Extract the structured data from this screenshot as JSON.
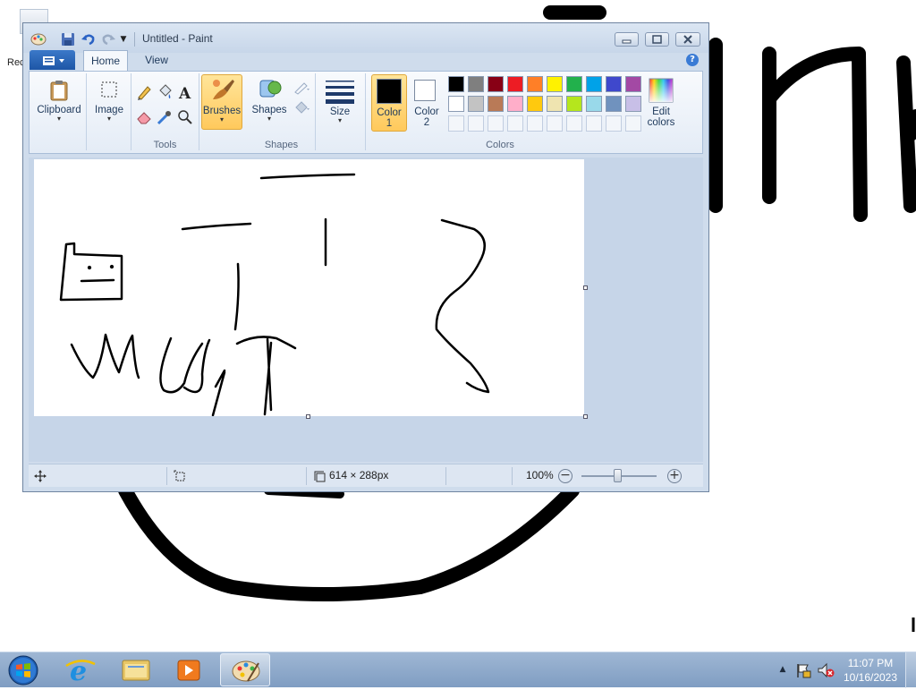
{
  "desktop": {
    "recycle_bin_label": "Rec",
    "icons": {
      "recycle_bin": "recycle-bin-icon"
    }
  },
  "window": {
    "title": "Untitled - Paint",
    "quick_access": [
      "paint-app-icon",
      "save-icon",
      "undo-icon",
      "redo-icon",
      "customize-arrow-icon"
    ],
    "caption_buttons": [
      "minimize",
      "maximize",
      "close"
    ]
  },
  "ribbon": {
    "tabs": [
      "Home",
      "View"
    ],
    "active_tab": "Home",
    "groups": {
      "clipboard": {
        "label": "Clipboard",
        "arrow": "▾"
      },
      "image": {
        "label": "Image",
        "arrow": "▾"
      },
      "tools": {
        "label": "Tools",
        "items": [
          "pencil",
          "fill",
          "text",
          "eraser",
          "color-picker",
          "magnifier"
        ]
      },
      "brushes": {
        "label": "Brushes",
        "arrow": "▾"
      },
      "shapes": {
        "label": "Shapes",
        "group_label": "Shapes",
        "arrow": "▾"
      },
      "size": {
        "label": "Size",
        "arrow": "▾"
      },
      "colors": {
        "group_label": "Colors",
        "color1_label_line1": "Color",
        "color1_label_line2": "1",
        "color2_label_line1": "Color",
        "color2_label_line2": "2",
        "color1_value": "#000000",
        "color2_value": "#ffffff",
        "palette_row1": [
          "#000000",
          "#7f7f7f",
          "#880015",
          "#ed1c24",
          "#ff7f27",
          "#fff200",
          "#22b14c",
          "#00a2e8",
          "#3f48cc",
          "#a349a4"
        ],
        "palette_row2": [
          "#ffffff",
          "#c3c3c3",
          "#b97a57",
          "#ffaec9",
          "#ffc90e",
          "#efe4b0",
          "#b5e61d",
          "#99d9ea",
          "#7092be",
          "#c8bfe7"
        ],
        "palette_row3_empty_count": 10
      },
      "edit_colors": {
        "label_line1": "Edit",
        "label_line2": "colors"
      }
    },
    "help": "?"
  },
  "canvas": {
    "background": "#ffffff",
    "stroke_color": "#000000"
  },
  "status": {
    "image_size": "614 × 288px",
    "zoom": "100%",
    "zoom_level": 100,
    "zoom_out": "−",
    "zoom_in": "+"
  },
  "taskbar": {
    "pinned": [
      "internet-explorer-icon",
      "windows-explorer-icon",
      "media-player-icon",
      "paint-icon"
    ],
    "active": "paint-icon",
    "clock_time": "11:07 PM",
    "clock_date": "10/16/2023",
    "tray_expand": "▲"
  },
  "colors": {
    "ribbon_highlight": "#ffc95c",
    "window_frame": "#cfdcec",
    "taskbar": "#8fa9cb"
  }
}
